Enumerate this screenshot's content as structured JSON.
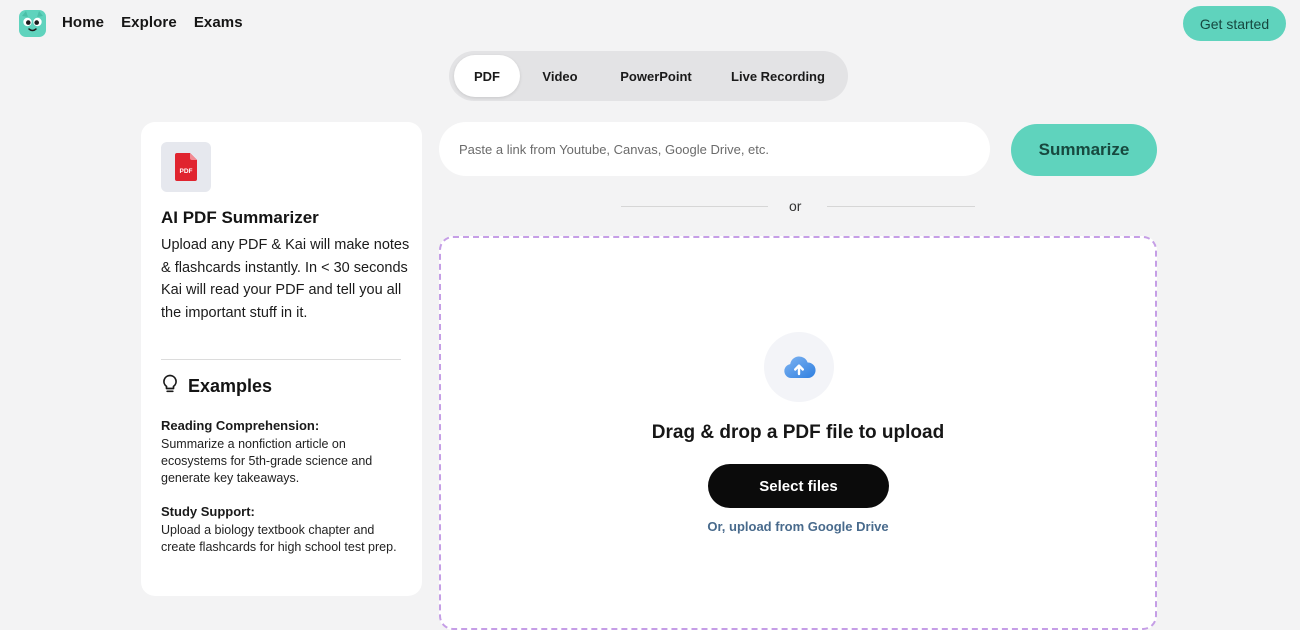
{
  "nav": {
    "logo_icon": "kai-mascot-logo",
    "links": [
      "Home",
      "Explore",
      "Exams"
    ],
    "cta_label": "Get started"
  },
  "tabs": {
    "items": [
      "PDF",
      "Video",
      "PowerPoint",
      "Live Recording"
    ],
    "active": "PDF"
  },
  "info_card": {
    "file_icon": "pdf-file-icon",
    "file_icon_text": "PDF",
    "title": "AI PDF Summarizer",
    "description": "Upload any PDF & Kai will make notes & flashcards instantly. In < 30 seconds Kai will read your PDF and tell you all the important stuff in it.",
    "examples_heading": "Examples",
    "examples_icon": "lightbulb-icon",
    "examples": [
      {
        "title": "Reading Comprehension:",
        "body": "Summarize a nonfiction article on ecosystems for 5th-grade science and generate key takeaways."
      },
      {
        "title": "Study Support:",
        "body": "Upload a biology textbook chapter and create flashcards for high school test prep."
      }
    ]
  },
  "link_input": {
    "placeholder": "Paste a link from Youtube, Canvas, Google Drive, etc.",
    "value": ""
  },
  "summarize_label": "Summarize",
  "divider_text": "or",
  "dropzone": {
    "icon": "cloud-upload-icon",
    "title": "Drag & drop a PDF file to upload",
    "select_label": "Select files",
    "alt_link": "Or, upload from Google Drive"
  },
  "colors": {
    "accent": "#5fd3bd",
    "dropzone_border": "#c59ee6",
    "link": "#486a8c",
    "pdf_red": "#e0242f"
  }
}
